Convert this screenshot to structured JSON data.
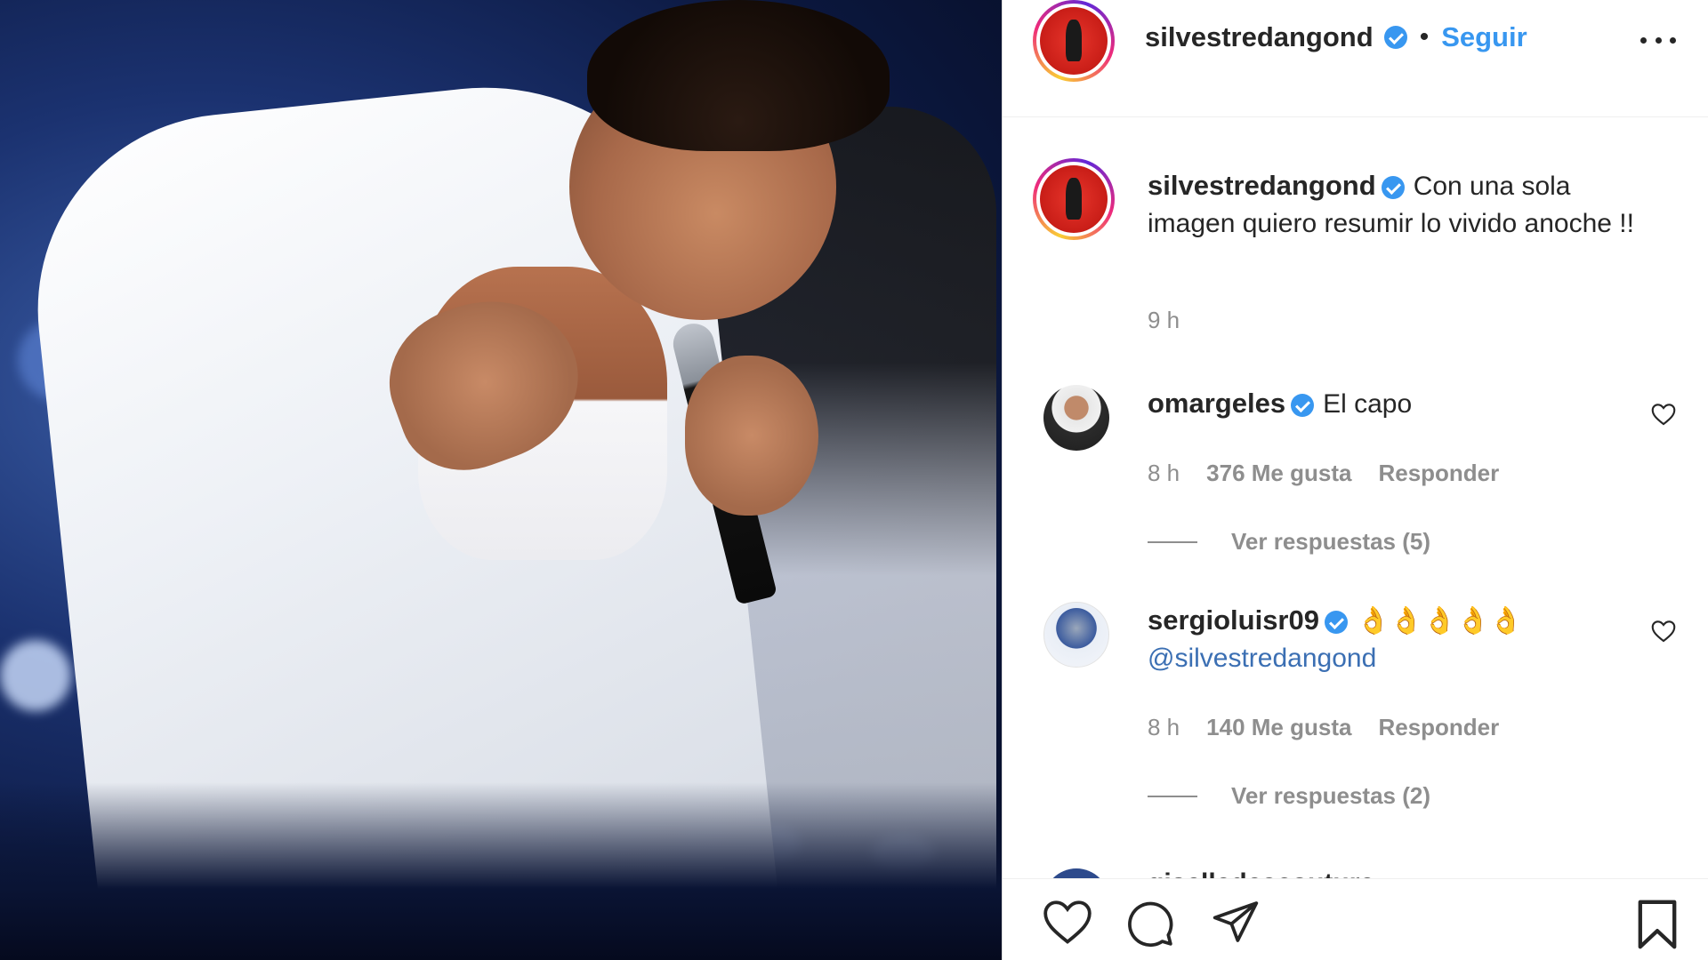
{
  "post": {
    "username": "silvestredangond",
    "verified": true,
    "follow_label": "Seguir",
    "separator": "•",
    "more_label": "more options"
  },
  "caption": {
    "username": "silvestredangond",
    "text": "Con una sola imagen quiero resumir lo vivido anoche !!",
    "time": "9 h"
  },
  "comments": [
    {
      "username": "omargeles",
      "verified": true,
      "text": "El capo",
      "time": "8 h",
      "likes": "376 Me gusta",
      "reply_label": "Responder",
      "view_replies": "Ver respuestas (5)"
    },
    {
      "username": "sergioluisr09",
      "verified": true,
      "text": "👌👌👌👌👌",
      "mention": "@silvestredangond",
      "time": "8 h",
      "likes": "140 Me gusta",
      "reply_label": "Responder",
      "view_replies": "Ver respuestas (2)"
    }
  ],
  "partial_comment": {
    "username_fragment": "giselledeacouture"
  },
  "actions": {
    "like_icon": "heart-icon",
    "comment_icon": "comment-icon",
    "share_icon": "share-icon",
    "save_icon": "bookmark-icon"
  },
  "colors": {
    "accent": "#3897f0",
    "text": "#262626",
    "muted": "#8e8e8e",
    "border": "#efefef"
  }
}
